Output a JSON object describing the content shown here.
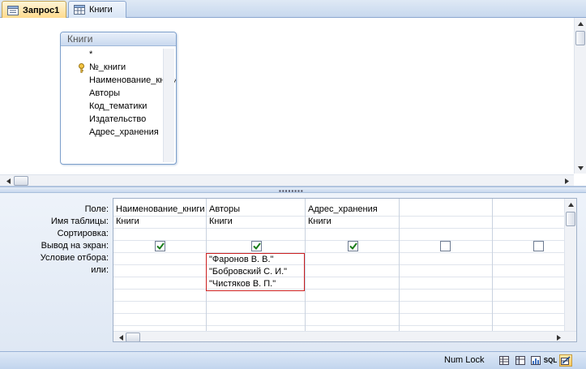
{
  "tabs": [
    {
      "label": "Запрос1",
      "active": true
    },
    {
      "label": "Книги",
      "active": false
    }
  ],
  "design_table": {
    "title": "Книги",
    "fields": [
      "*",
      "№_книги",
      "Наименование_книги",
      "Авторы",
      "Код_тематики",
      "Издательство",
      "Адрес_хранения"
    ],
    "key_field": "№_книги"
  },
  "grid": {
    "row_labels": [
      "Поле:",
      "Имя таблицы:",
      "Сортировка:",
      "Вывод на экран:",
      "Условие отбора:",
      "или:"
    ],
    "columns": [
      {
        "field": "Наименование_книги",
        "table": "Книги",
        "show": true,
        "criteria": []
      },
      {
        "field": "Авторы",
        "table": "Книги",
        "show": true,
        "criteria": [
          "\"Фаронов В. В.\"",
          "\"Бобровский С. И.\"",
          "\"Чистяков В. П.\""
        ]
      },
      {
        "field": "Адрес_хранения",
        "table": "Книги",
        "show": true,
        "criteria": []
      },
      {
        "field": "",
        "table": "",
        "show": false,
        "criteria": []
      },
      {
        "field": "",
        "table": "",
        "show": false,
        "criteria": []
      }
    ]
  },
  "status": {
    "num_lock": "Num Lock",
    "views": [
      {
        "icon": "datasheet-view-icon",
        "active": false
      },
      {
        "icon": "pivot-table-view-icon",
        "active": false
      },
      {
        "icon": "pivot-chart-view-icon",
        "active": false
      },
      {
        "icon": "sql-view-icon",
        "label": "SQL",
        "active": false
      },
      {
        "icon": "design-view-icon",
        "active": true
      }
    ]
  },
  "colors": {
    "accent": "#ffd98a",
    "criteria_border": "#cc1f1f",
    "checkmark": "#1b7d1b"
  }
}
